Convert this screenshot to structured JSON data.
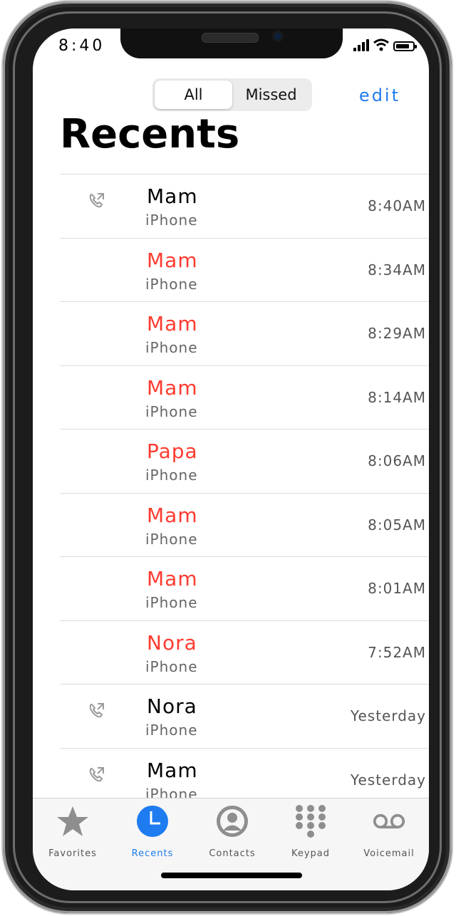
{
  "status_bar": {
    "time": "8:40"
  },
  "header": {
    "segments": [
      "All",
      "Missed"
    ],
    "active_segment": "All",
    "edit_label": "edit",
    "title": "Recents"
  },
  "colors": {
    "accent": "#1f7cf0",
    "missed": "#ff3b30",
    "normal": "#000000",
    "muted": "#666666"
  },
  "calls": [
    {
      "name": "Mam",
      "type": "iPhone",
      "time": "8:40AM",
      "missed": false,
      "icon": "outgoing-call-icon"
    },
    {
      "name": "Mam",
      "type": "iPhone",
      "time": "8:34AM",
      "missed": true
    },
    {
      "name": "Mam",
      "type": "iPhone",
      "time": "8:29AM",
      "missed": true
    },
    {
      "name": "Mam",
      "type": "iPhone",
      "time": "8:14AM",
      "missed": true
    },
    {
      "name": "Papa",
      "type": "iPhone",
      "time": "8:06AM",
      "missed": true
    },
    {
      "name": "Mam",
      "type": "iPhone",
      "time": "8:05AM",
      "missed": true
    },
    {
      "name": "Mam",
      "type": "iPhone",
      "time": "8:01AM",
      "missed": true
    },
    {
      "name": "Nora",
      "type": "iPhone",
      "time": "7:52AM",
      "missed": true
    },
    {
      "name": "Nora",
      "type": "iPhone",
      "time": "Yesterday",
      "missed": false,
      "icon": "outgoing-call-icon"
    },
    {
      "name": "Mam",
      "type": "iPhone",
      "time": "Yesterday",
      "missed": false,
      "icon": "outgoing-call-icon"
    }
  ],
  "tabbar": {
    "tabs": [
      {
        "label": "Favorites",
        "icon": "star-icon",
        "active": false
      },
      {
        "label": "Recents",
        "icon": "clock-icon",
        "active": true
      },
      {
        "label": "Contacts",
        "icon": "person-icon",
        "active": false
      },
      {
        "label": "Keypad",
        "icon": "keypad-icon",
        "active": false
      },
      {
        "label": "Voicemail",
        "icon": "voicemail-icon",
        "active": false
      }
    ]
  }
}
